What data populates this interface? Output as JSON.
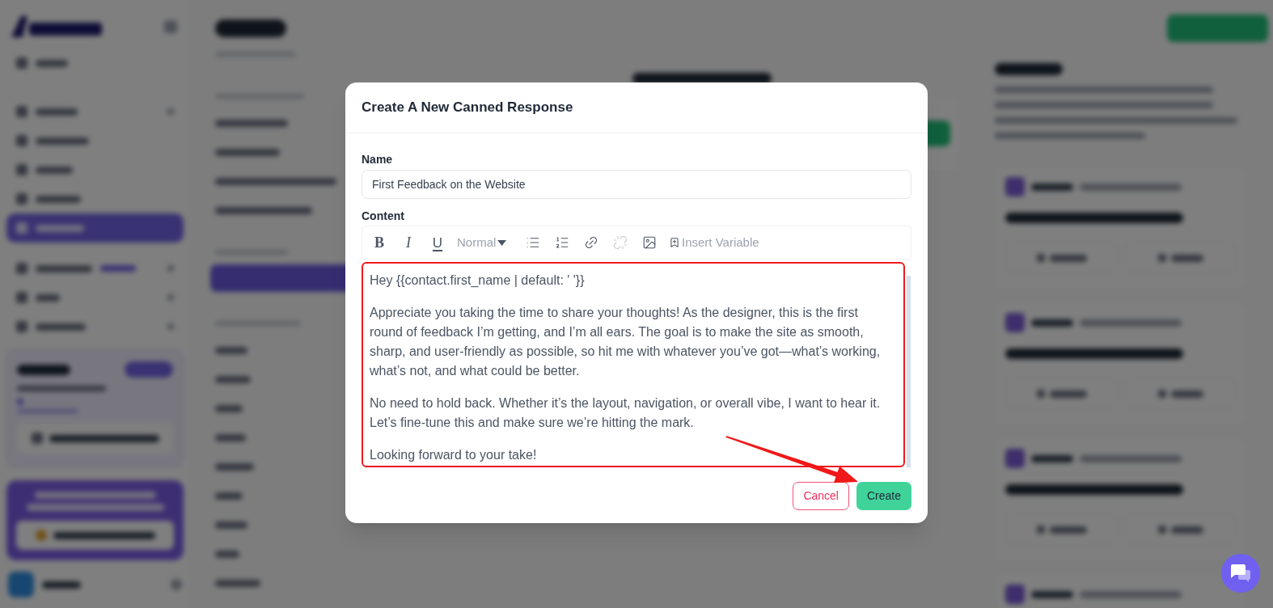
{
  "modal": {
    "title": "Create A New Canned Response",
    "name_field": {
      "label": "Name",
      "value": "First Feedback on the Website"
    },
    "content_field": {
      "label": "Content",
      "toolbar": [
        {
          "kind": "bold",
          "glyph": "B",
          "disabled": false
        },
        {
          "kind": "italic",
          "glyph": "I",
          "disabled": false
        },
        {
          "kind": "underline",
          "glyph": "U",
          "disabled": false
        },
        {
          "kind": "heading_select",
          "label": "Normal",
          "disabled": false
        },
        {
          "kind": "bullet_list",
          "disabled": false
        },
        {
          "kind": "ordered_list",
          "disabled": false
        },
        {
          "kind": "link",
          "disabled": false
        },
        {
          "kind": "unlink",
          "disabled": true
        },
        {
          "kind": "image",
          "disabled": false
        },
        {
          "kind": "insert_variable",
          "label": "Insert Variable",
          "disabled": false
        }
      ],
      "paragraphs": [
        "Hey {{contact.first_name | default: ' '}}",
        "Appreciate you taking the time to share your thoughts! As the designer, this is the first round of feedback I’m getting, and I’m all ears. The goal is to make the site as smooth, sharp, and user-friendly as possible, so hit me with whatever you’ve got—what’s working, what’s not, and what could be better.",
        "No need to hold back. Whether it’s the layout, navigation, or overall vibe, I want to hear it. Let’s fine-tune this and make sure we’re hitting the mark.",
        "Looking forward to your take!"
      ]
    },
    "buttons": [
      {
        "kind": "cancel",
        "label": "Cancel"
      },
      {
        "kind": "create",
        "label": "Create"
      }
    ]
  }
}
